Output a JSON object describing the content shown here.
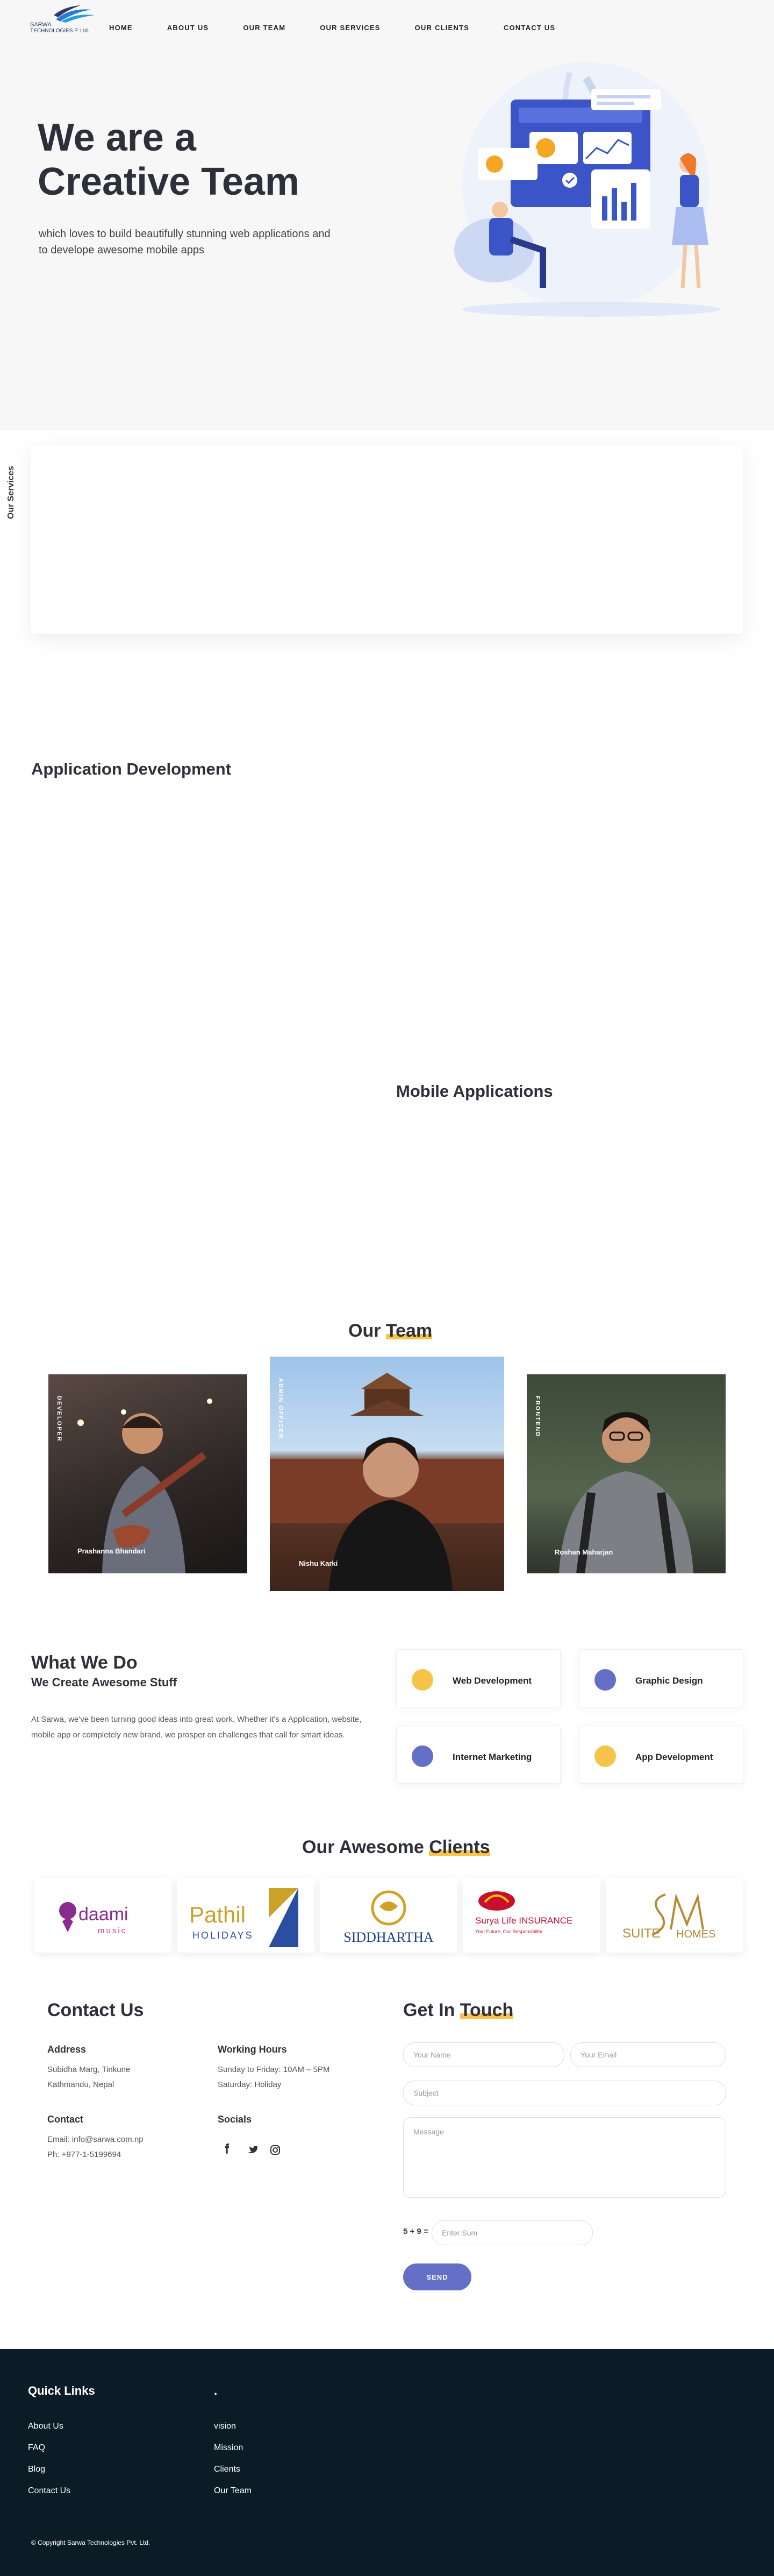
{
  "brand": {
    "logo_text_line1": "SARWA",
    "logo_text_line2": "TECHNOLOGIES P. Ltd.",
    "accent": "#f7c44b",
    "primary": "#6470c8"
  },
  "nav": {
    "items": [
      "HOME",
      "ABOUT US",
      "OUR TEAM",
      "OUR SERVICES",
      "OUR CLIENTS",
      "CONTACT US"
    ]
  },
  "hero": {
    "title_line1": "We are a",
    "title_highlight": "Creative",
    "title_rest": " Team",
    "subtitle": "which loves to build beautifully stunning web applications and to develope awesome mobile apps"
  },
  "services": {
    "vertical_label": "Our Services",
    "app_dev_title": "Application Development",
    "mobile_title": "Mobile Applications"
  },
  "team": {
    "title_plain": "Our ",
    "title_highlight": "Team",
    "members": [
      {
        "role": "DEVELOPER",
        "name": "Prashanna Bhandari"
      },
      {
        "role": "ADMIN OFFICER",
        "name": "Nishu Karki"
      },
      {
        "role": "FRONTEND",
        "name": "Roshan Maharjan"
      }
    ]
  },
  "what_we_do": {
    "title": "What We Do",
    "subtitle": "We Create Awesome Stuff",
    "text": "At Sarwa, we've been turning good ideas into great work. Whether it's a Application, website, mobile app or completely new brand, we prosper on challenges that call for smart ideas.",
    "services": [
      {
        "label": "Web Development",
        "color": "#f7c44b"
      },
      {
        "label": "Graphic Design",
        "color": "#6470c8"
      },
      {
        "label": "Internet Marketing",
        "color": "#6470c8"
      },
      {
        "label": "App Development",
        "color": "#f7c44b"
      }
    ]
  },
  "clients": {
    "title_plain": "Our Awesome ",
    "title_highlight": "Clients",
    "logos": [
      {
        "name": "daami",
        "sub": "music"
      },
      {
        "name": "Pathil",
        "sub": "HOLIDAYS"
      },
      {
        "name": "SIDDHARTHA",
        "sub": ""
      },
      {
        "name": "Surya Life INSURANCE",
        "sub": "Your Future, Our Responsibility"
      },
      {
        "name": "SUITE",
        "sub": "HOMES"
      }
    ]
  },
  "contact": {
    "title": "Contact Us",
    "address_head": "Address",
    "address": [
      "Subidha Marg, Tinkune",
      "Kathmandu, Nepal"
    ],
    "hours_head": "Working Hours",
    "hours": [
      "Sunday to Friday: 10AM – 5PM",
      "Saturday: Holiday"
    ],
    "contact_head": "Contact",
    "contact_lines": [
      "Email: info@sarwa.com.np",
      "Ph: +977-1-5199694"
    ],
    "socials_head": "Socials"
  },
  "form": {
    "title_plain": "Get In ",
    "title_highlight": "Touch",
    "name_placeholder": "Your Name",
    "email_placeholder": "Your Email",
    "subject_placeholder": "Subject",
    "message_placeholder": "Message",
    "sum_label": "5 + 9 =",
    "sum_placeholder": "Enter Sum",
    "send_label": "SEND"
  },
  "footer": {
    "quick_links_head": "Quick Links",
    "second_head": ".",
    "col1": [
      "About Us",
      "FAQ",
      "Blog",
      "Contact Us"
    ],
    "col2": [
      "vision",
      "Mission",
      "Clients",
      "Our Team"
    ],
    "copyright": "© Copyright Sarwa Technologies Pvt. Ltd."
  }
}
